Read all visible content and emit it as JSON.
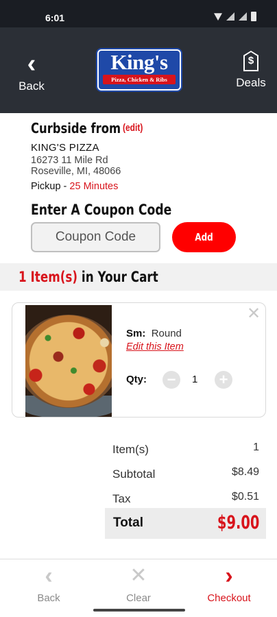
{
  "status_bar": {
    "time": "6:01"
  },
  "header": {
    "back_label": "Back",
    "deals_label": "Deals",
    "logo": {
      "name": "King's",
      "tagline": "Pizza, Chicken & Ribs",
      "colors": {
        "brand_blue": "#1f49a8",
        "brand_red": "#d8141c"
      }
    },
    "icons": {
      "back": "chevron-left-icon",
      "deals": "price-tag-icon"
    }
  },
  "pickup_info": {
    "title": "Curbside from",
    "edit_label": "(edit)",
    "store_name": "KING'S PIZZA",
    "address_line1": "16273 11 Mile Rd",
    "address_line2": "Roseville, MI, 48066",
    "pickup_label": "Pickup",
    "pickup_separator": " - ",
    "pickup_time": "25 Minutes"
  },
  "coupon": {
    "title": "Enter A Coupon Code",
    "placeholder": "Coupon Code",
    "value": "",
    "add_label": "Add"
  },
  "cart": {
    "count_label": "1 Item(s)",
    "header_suffix": " in Your Cart",
    "items": [
      {
        "size_label": "Sm:",
        "size_value": "Round",
        "edit_label": "Edit this Item",
        "qty_label": "Qty:",
        "qty": "1",
        "image": "pizza-photo"
      }
    ]
  },
  "summary": {
    "items_label": "Item(s)",
    "items_value": "1",
    "subtotal_label": "Subtotal",
    "subtotal_value": "$8.49",
    "tax_label": "Tax",
    "tax_value": "$0.51",
    "total_label": "Total",
    "total_value": "$9.00"
  },
  "bottom_nav": {
    "back_label": "Back",
    "clear_label": "Clear",
    "checkout_label": "Checkout",
    "accent_color": "#d8141c"
  }
}
